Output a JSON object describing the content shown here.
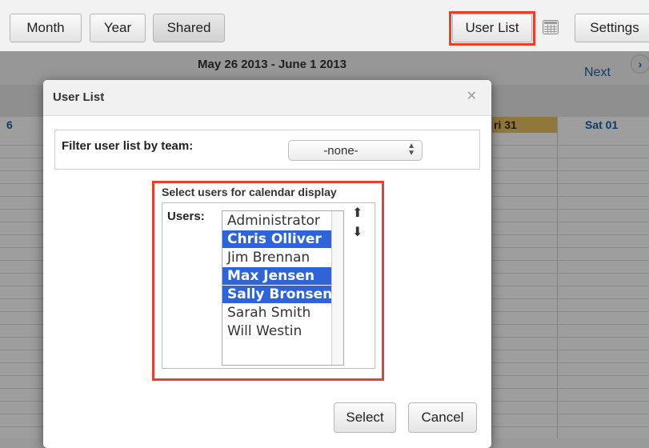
{
  "toolbar": {
    "month_label": "Month",
    "year_label": "Year",
    "shared_label": "Shared",
    "user_list_label": "User List",
    "calendar_icon": "calendar-grid-icon",
    "settings_label": "Settings"
  },
  "calendar": {
    "date_range": "May 26 2013 - June 1 2013",
    "next_label": "Next",
    "next_icon": "chevron-right-icon",
    "day_partial_left": "6",
    "day_fri": "ri 31",
    "day_sat": "Sat 01",
    "today_color": "#e8c060"
  },
  "modal": {
    "title": "User List",
    "close_icon": "close-icon",
    "filter_label": "Filter user list by team:",
    "team_select_value": "-none-",
    "section_title": "Select users for calendar display",
    "users_label": "Users:",
    "users": [
      {
        "name": "Administrator",
        "selected": false
      },
      {
        "name": "Chris Olliver",
        "selected": true
      },
      {
        "name": "Jim Brennan",
        "selected": false
      },
      {
        "name": "Max Jensen",
        "selected": true
      },
      {
        "name": "Sally Bronsen",
        "selected": true
      },
      {
        "name": "Sarah Smith",
        "selected": false
      },
      {
        "name": "Will Westin",
        "selected": false
      }
    ],
    "move_up_icon": "arrow-up-icon",
    "move_down_icon": "arrow-down-icon",
    "select_label": "Select",
    "cancel_label": "Cancel"
  },
  "colors": {
    "highlight": "#e8402a",
    "selection": "#2f64d8",
    "link": "#1a5fa8"
  }
}
